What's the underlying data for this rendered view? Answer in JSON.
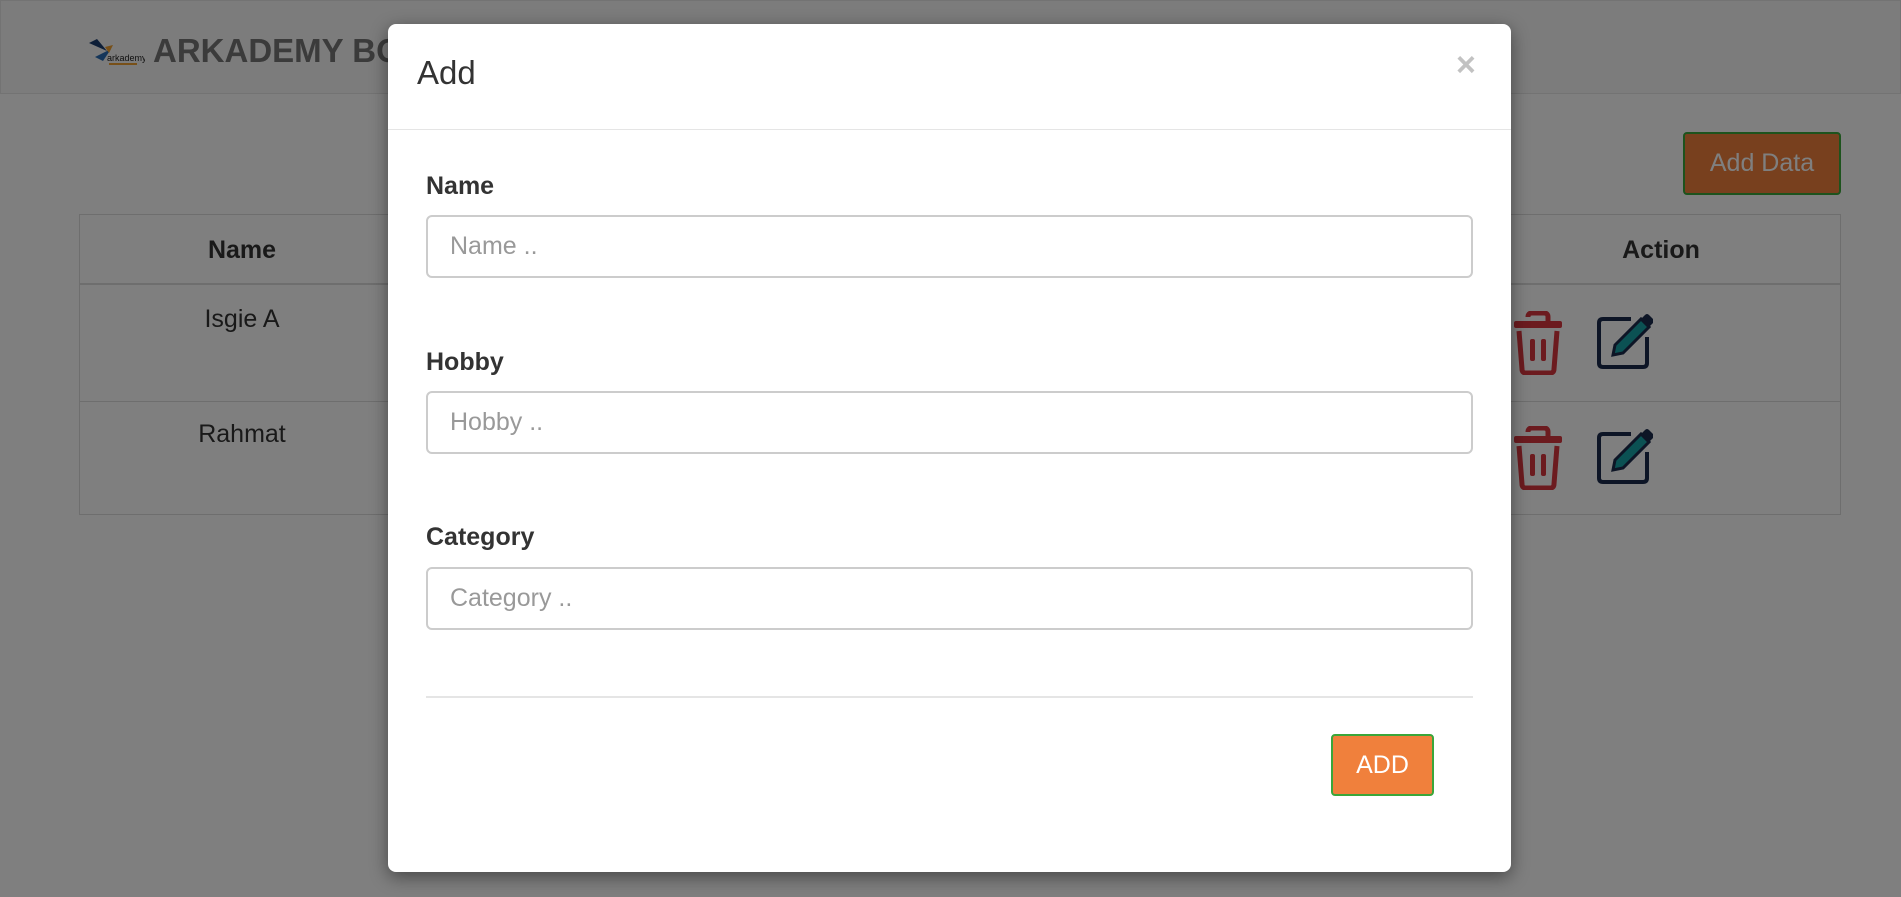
{
  "navbar": {
    "brand_logo_text": "arkademy",
    "brand_name": "ARKADEMY BOOTCAMP"
  },
  "toolbar": {
    "add_data_label": "Add Data"
  },
  "table": {
    "headers": {
      "name": "Name",
      "action": "Action"
    },
    "rows": [
      {
        "name": "Isgie A"
      },
      {
        "name": "Rahmat"
      }
    ],
    "icons": {
      "delete": "trash-icon",
      "edit": "edit-icon"
    }
  },
  "modal": {
    "title": "Add",
    "close_glyph": "×",
    "fields": [
      {
        "label": "Name",
        "placeholder": "Name ..",
        "value": ""
      },
      {
        "label": "Hobby",
        "placeholder": "Hobby ..",
        "value": ""
      },
      {
        "label": "Category",
        "placeholder": "Category ..",
        "value": ""
      }
    ],
    "submit_label": "ADD"
  },
  "colors": {
    "accent": "#f0803c",
    "accent_border": "#3aa63a",
    "delete_icon": "#d9363e",
    "edit_icon_fill": "#17a2a6",
    "edit_icon_outline": "#1a2b4c"
  }
}
